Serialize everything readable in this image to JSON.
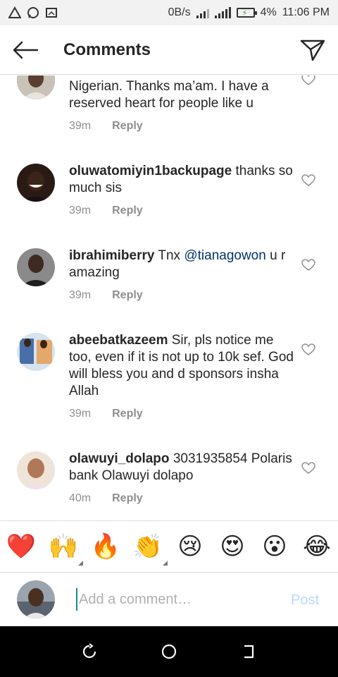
{
  "status_bar": {
    "network_speed": "0B/s",
    "battery_percent": "4%",
    "time": "11:06 PM"
  },
  "header": {
    "title": "Comments"
  },
  "comments": [
    {
      "username": "",
      "text": "Nigerian. Thanks ma’am. I have a reserved heart for people like u",
      "time": "39m",
      "reply_label": "Reply"
    },
    {
      "username": "oluwatomiyin1backupage",
      "text": "thanks so much sis",
      "time": "39m",
      "reply_label": "Reply"
    },
    {
      "username": "ibrahimiberry",
      "text": "Tnx",
      "mention": "@tianagowon",
      "text_after": "u r amazing",
      "time": "39m",
      "reply_label": "Reply"
    },
    {
      "username": "abeebatkazeem",
      "text": "Sir, pls notice me too, even if it is not up to 10k sef. God will bless you and d sponsors insha Allah",
      "time": "39m",
      "reply_label": "Reply"
    },
    {
      "username": "olawuyi_dolapo",
      "text": "3031935854 Polaris bank Olawuyi dolapo",
      "time": "40m",
      "reply_label": "Reply"
    }
  ],
  "emoji_bar": [
    {
      "glyph": "❤️",
      "name": "red-heart"
    },
    {
      "glyph": "🙌",
      "name": "raising-hands",
      "tone_selector": true
    },
    {
      "glyph": "🔥",
      "name": "fire"
    },
    {
      "glyph": "👏",
      "name": "clapping-hands",
      "tone_selector": true
    },
    {
      "glyph": "😢",
      "name": "crying-face"
    },
    {
      "glyph": "😍",
      "name": "heart-eyes-face"
    },
    {
      "glyph": "😮",
      "name": "surprised-face"
    },
    {
      "glyph": "😂",
      "name": "tears-of-joy-face"
    }
  ],
  "compose": {
    "placeholder": "Add a comment…",
    "post_label": "Post"
  },
  "colors": {
    "mention": "#003569",
    "meta": "#8e8e8e",
    "post_disabled": "#b3dbff",
    "divider": "#dbdbdb"
  }
}
